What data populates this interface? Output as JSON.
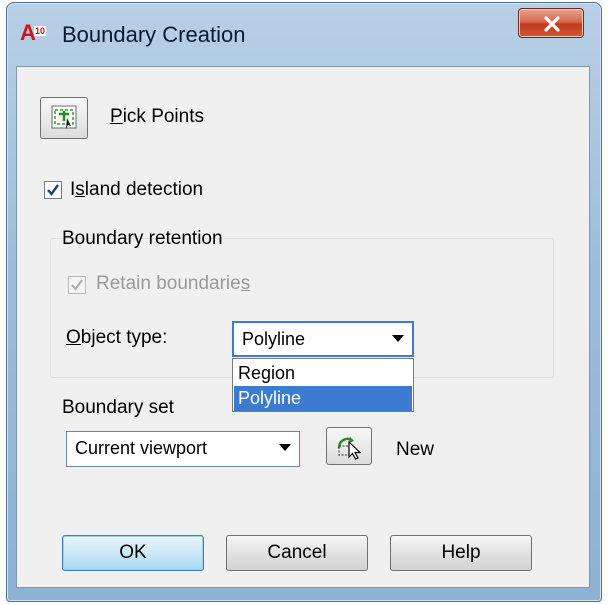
{
  "window": {
    "title": "Boundary Creation",
    "app_icon_letter": "A",
    "app_icon_version": "10",
    "close_icon": "close-x-icon"
  },
  "pick_points": {
    "icon": "pick-points-icon",
    "label_mnemonic": "P",
    "label_rest": "ick Points"
  },
  "island_detection": {
    "checked": true,
    "label_pre": "I",
    "label_mnemonic": "s",
    "label_rest": "land detection"
  },
  "boundary_retention": {
    "heading": "Boundary retention",
    "retain": {
      "checked": true,
      "disabled": true,
      "label_pre": "Retain boundarie",
      "label_mnemonic": "s"
    },
    "object_type": {
      "label_mnemonic": "O",
      "label_rest": "bject type:",
      "value": "Polyline",
      "options": [
        "Region",
        "Polyline"
      ],
      "selected_index": 1
    }
  },
  "boundary_set": {
    "heading": "Boundary set",
    "value": "Current viewport",
    "new_label": "New",
    "new_icon": "select-objects-icon"
  },
  "buttons": {
    "ok": "OK",
    "cancel": "Cancel",
    "help": "Help"
  },
  "colors": {
    "selection": "#3d7ad1",
    "close_button": "#c0391d",
    "frame": "#9ebcd8"
  }
}
